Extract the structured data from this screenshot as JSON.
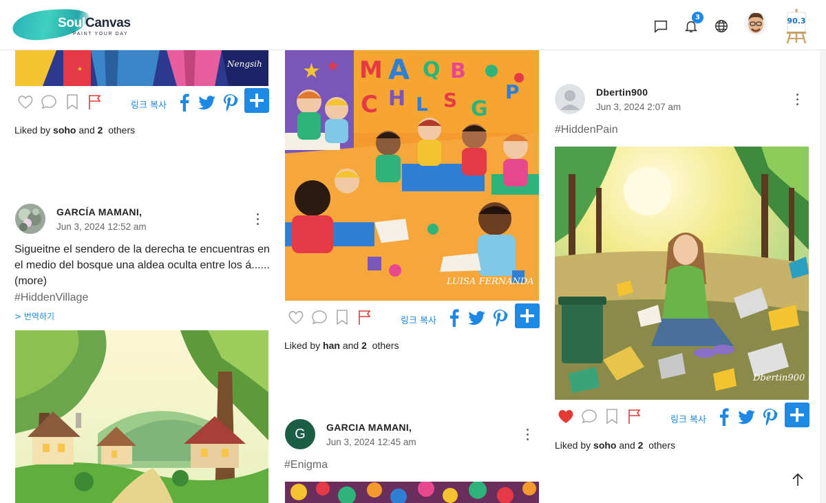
{
  "app": {
    "logo_soul": "Soul",
    "logo_canvas": "Canvas",
    "logo_tagline": "PAINT YOUR DAY",
    "notification_count": "3",
    "points": "90.3"
  },
  "actions": {
    "copy_link": "링크 복사",
    "translate": "> 번역하기",
    "liked_prefix": "Liked by",
    "liked_and": "and",
    "liked_others": "others"
  },
  "posts": [
    {
      "liked_user": "soho",
      "liked_count": "2",
      "image_signature": "Nengsih"
    },
    {
      "author": "GARCÍA MAMANI,",
      "time": "Jun 3, 2024 12:52 am",
      "text": "Sigueitne el sendero de la derecha te encuentras en el medio del bosque una aldea oculta entre los á......(more)",
      "hashtag": "#HiddenVillage"
    },
    {
      "liked_user": "han",
      "liked_count": "2",
      "image_signature": "LUISA FERNANDA"
    },
    {
      "author": "GARCIA MAMANI,",
      "avatar_letter": "G",
      "time": "Jun 3, 2024 12:45 am",
      "hashtag": "#Enigma"
    },
    {
      "author": "Dbertin900",
      "time": "Jun 3, 2024 2:07 am",
      "hashtag": "#HiddenPain",
      "liked_user": "soho",
      "liked_count": "2",
      "image_signature": "Dbertin900",
      "liked": true
    }
  ],
  "colors": {
    "accent": "#1e88e5",
    "like_red": "#e53935",
    "flag_red": "#e53935",
    "g_avatar": "#1b5e45"
  },
  "icons": [
    "chat-icon",
    "bell-icon",
    "globe-icon",
    "heart-icon",
    "comment-icon",
    "bookmark-icon",
    "flag-icon",
    "facebook-icon",
    "twitter-icon",
    "pinterest-icon",
    "plus-icon",
    "arrow-up-icon",
    "more-icon"
  ]
}
